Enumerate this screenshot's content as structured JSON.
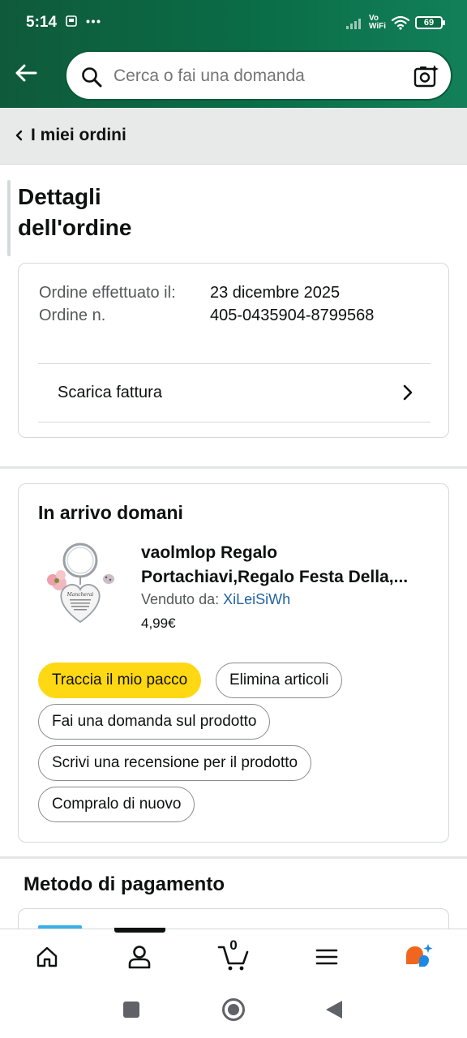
{
  "status_bar": {
    "time": "5:14",
    "vowifi_top": "Vo",
    "vowifi_bottom": "WiFi",
    "battery": "69"
  },
  "header": {
    "search_placeholder": "Cerca o fai una domanda"
  },
  "breadcrumb": {
    "label": "I miei ordini"
  },
  "page": {
    "title_line1": "Dettagli",
    "title_line2": "dell'ordine"
  },
  "order_info": {
    "placed_label": "Ordine effettuato il:",
    "placed_value": "23 dicembre 2025",
    "number_label": "Ordine n.",
    "number_value": "405-0435904-8799568",
    "invoice_label": "Scarica fattura"
  },
  "shipment": {
    "status": "In arrivo domani",
    "product_title_line1": "vaolmlop Regalo",
    "product_title_line2": "Portachiavi,Regalo Festa Della,...",
    "seller_label": "Venduto da: ",
    "seller_name": "XiLeiSiWh",
    "price": "4,99€",
    "actions": {
      "track": "Traccia il mio pacco",
      "delete": "Elimina articoli",
      "ask": "Fai una domanda sul prodotto",
      "review": "Scrivi una recensione per il prodotto",
      "buy_again": "Compralo di nuovo"
    }
  },
  "payment": {
    "title": "Metodo di pagamento"
  },
  "bottom_nav": {
    "items": [
      "home-icon",
      "account-icon",
      "cart-icon",
      "menu-icon",
      "rufus-icon"
    ],
    "cart_count": "0"
  },
  "colors": {
    "header_green": "#0a6d47",
    "primary_button": "#ffd814",
    "link": "#2162a1"
  }
}
